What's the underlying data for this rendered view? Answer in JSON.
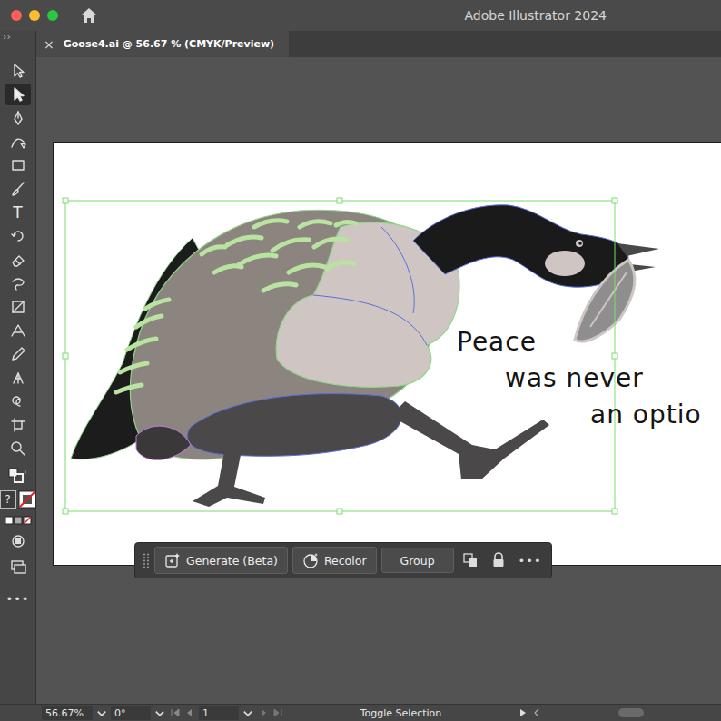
{
  "window": {
    "title": "Adobe Illustrator 2024"
  },
  "document_tab": {
    "label": "Goose4.ai @ 56.67 % (CMYK/Preview)",
    "close": "×"
  },
  "toolbar": {
    "collapse": "››",
    "tools": [
      {
        "kind": "icon",
        "selected": false
      },
      {
        "kind": "icon",
        "selected": true
      },
      {
        "kind": "icon",
        "selected": false
      },
      {
        "kind": "icon",
        "selected": false
      },
      {
        "kind": "icon",
        "selected": false
      },
      {
        "kind": "icon",
        "selected": false
      },
      {
        "kind": "text",
        "label": "T",
        "selected": false
      },
      {
        "kind": "icon",
        "selected": false
      },
      {
        "kind": "icon",
        "selected": false
      },
      {
        "kind": "icon",
        "selected": false
      },
      {
        "kind": "icon",
        "selected": false
      },
      {
        "kind": "icon",
        "selected": false
      },
      {
        "kind": "icon",
        "selected": false
      },
      {
        "kind": "icon",
        "selected": false
      },
      {
        "kind": "icon",
        "selected": false
      },
      {
        "kind": "icon",
        "selected": false
      },
      {
        "kind": "icon",
        "selected": false
      }
    ],
    "fill_unknown": "?",
    "more": "•••"
  },
  "artboard": {
    "text_lines": [
      "Peace",
      "was never",
      "an optio"
    ],
    "artwork_selected": true
  },
  "context_bar": {
    "buttons": [
      {
        "label": "Generate (Beta)",
        "kind": "generate"
      },
      {
        "label": "Recolor",
        "kind": "recolor"
      },
      {
        "label": "Group",
        "kind": "plain"
      }
    ],
    "more": "•••"
  },
  "status_bar": {
    "zoom": "56.67%",
    "rotation": "0°",
    "artboard": "1",
    "tool_info": "Toggle Selection"
  }
}
